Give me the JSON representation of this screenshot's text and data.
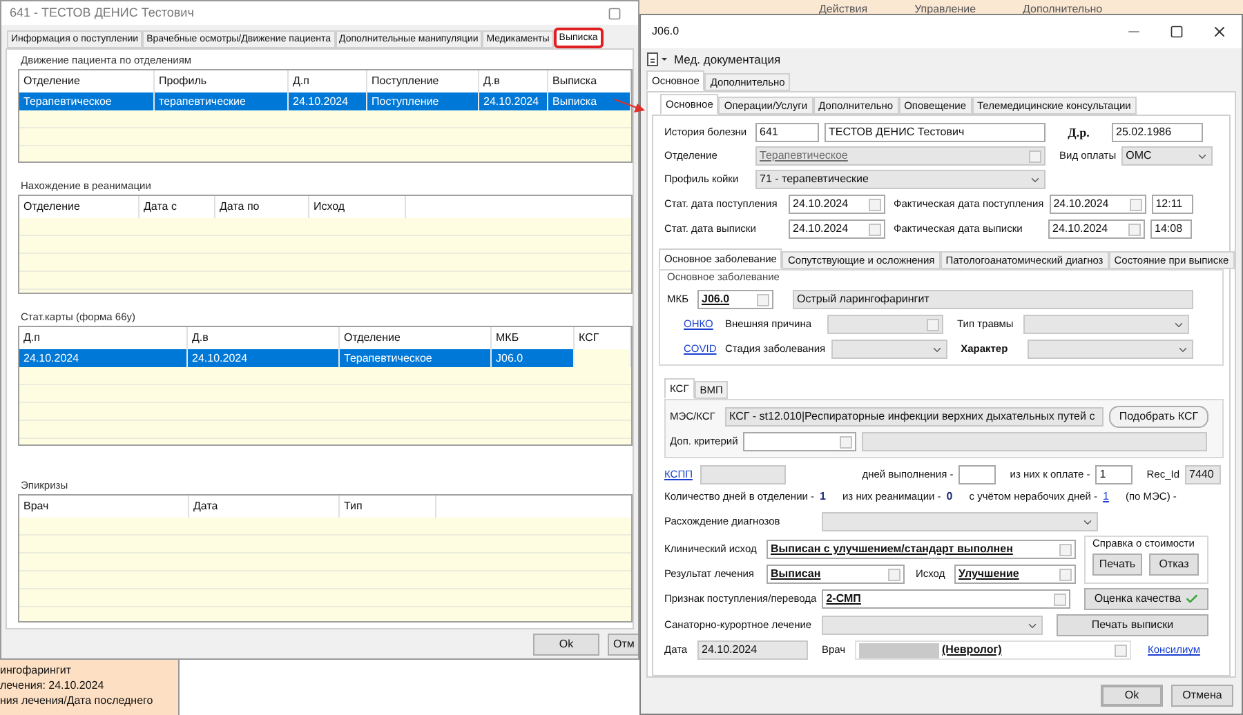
{
  "background": {
    "toolbar_labels": [
      "Действия",
      "Управление",
      "Дополнительно"
    ],
    "note_lines": [
      "ингофарингит",
      "лечения: 24.10.2024",
      "ния лечения/Дата последнего"
    ]
  },
  "left_window": {
    "title": "641 - ТЕСТОВ ДЕНИС Тестович",
    "tabs": [
      {
        "label": "Информация о поступлении",
        "selected": false,
        "highlighted": false
      },
      {
        "label": "Врачебные осмотры/Движение пациента",
        "selected": false,
        "highlighted": false
      },
      {
        "label": "Дополнительные манипуляции",
        "selected": false,
        "highlighted": false
      },
      {
        "label": "Медикаменты",
        "selected": false,
        "highlighted": false
      },
      {
        "label": "Выписка",
        "selected": true,
        "highlighted": true
      }
    ],
    "grids": [
      {
        "title": "Движение пациента по отделениям",
        "columns": [
          "Отделение",
          "Профиль",
          "Д.п",
          "Поступление",
          "Д.в",
          "Выписка"
        ],
        "rows": [
          {
            "cells": [
              "Терапевтическое",
              "терапевтические",
              "24.10.2024",
              "Поступление",
              "24.10.2024",
              "Выписка"
            ],
            "selected": true
          }
        ]
      },
      {
        "title": "Нахождение в реанимации",
        "columns": [
          "Отделение",
          "Дата с",
          "Дата по",
          "Исход"
        ]
      },
      {
        "title": "Стат.карты (форма 66у)",
        "columns": [
          "Д.п",
          "Д.в",
          "Отделение",
          "МКБ",
          "КСГ"
        ],
        "rows": [
          {
            "cells": [
              "24.10.2024",
              "24.10.2024",
              "Терапевтическое",
              "J06.0"
            ],
            "selected": true
          }
        ]
      },
      {
        "title": "Эпикризы",
        "columns": [
          "Врач",
          "Дата",
          "Тип"
        ]
      }
    ],
    "buttons": [
      "Ok",
      "Отм"
    ]
  },
  "right_window": {
    "title": "J06.0",
    "menu": "Мед. документация",
    "outer_tabs": [
      {
        "label": "Основное",
        "selected": true
      },
      {
        "label": "Дополнительно",
        "selected": false
      }
    ],
    "inner_tabs": [
      {
        "label": "Основное",
        "selected": true
      },
      {
        "label": "Операции/Услуги",
        "selected": false
      },
      {
        "label": "Дополнительно",
        "selected": false
      },
      {
        "label": "Оповещение",
        "selected": false
      },
      {
        "label": "Телемедицинские консультации",
        "selected": false
      }
    ],
    "history": {
      "label": "История болезни",
      "number": "641",
      "name": "ТЕСТОВ ДЕНИС Тестович",
      "dob_label": "Д.р.",
      "dob": "25.02.1986"
    },
    "department": {
      "label": "Отделение",
      "value": "Терапевтическое",
      "disabled": true
    },
    "payment": {
      "label": "Вид оплаты",
      "value": "ОМС"
    },
    "bed_profile": {
      "label": "Профиль койки",
      "value": "71 - терапевтические"
    },
    "dates": [
      {
        "label": "Стат. дата поступления",
        "date": "24.10.2024",
        "actual_label": "Фактическая дата поступления",
        "actual_date": "24.10.2024",
        "time": "12:11"
      },
      {
        "label": "Стат. дата выписки",
        "date": "24.10.2024",
        "actual_label": "Фактическая дата выписки",
        "actual_date": "24.10.2024",
        "time": "14:08"
      }
    ],
    "diagnosis_tabs": [
      {
        "label": "Основное заболевание",
        "selected": true
      },
      {
        "label": "Сопутствующие и осложнения",
        "selected": false
      },
      {
        "label": "Патологоанатомический диагноз",
        "selected": false
      },
      {
        "label": "Состояние при выписке",
        "selected": false
      }
    ],
    "diagnosis": {
      "group": "Основное заболевание",
      "mkb_label": "МКБ",
      "mkb": "J06.0",
      "mkb_name": "Острый ларингофарингит",
      "onko": "ОНКО",
      "external_cause": "Внешняя причина",
      "trauma_type": "Тип травмы",
      "covid": "COVID",
      "stage": "Стадия заболевания",
      "character": "Характер"
    },
    "ksg_tabs": [
      {
        "label": "КСГ",
        "selected": true
      },
      {
        "label": "ВМП",
        "selected": false
      }
    ],
    "ksg": {
      "mes_label": "МЭС/КСГ",
      "mes": "КСГ - st12.010|Респираторные инфекции верхних дыхательных путей с",
      "pick_button": "Подобрать КСГ",
      "extra_label": "Доп. критерий"
    },
    "kspp": {
      "link": "КСПП",
      "days_label": "дней выполнения -",
      "paid_label": "из них к оплате -",
      "paid": "1",
      "rec_label": "Rec_Id",
      "rec": "7440"
    },
    "counts": [
      {
        "label": "Количество дней в отделении -",
        "value": "1",
        "kind": "plain"
      },
      {
        "label": "из них реанимации -",
        "value": "0",
        "kind": "plain"
      },
      {
        "label": "с учётом нерабочих дней -",
        "value": "1",
        "kind": "link"
      }
    ],
    "mes_days_label": "(по МЭС) -",
    "discrepancy_label": "Расхождение диагнозов",
    "clinical_outcome": {
      "label": "Клинический исход",
      "value": "Выписан с улучшением/стандарт выполнен"
    },
    "result": {
      "label": "Результат лечения",
      "value": "Выписан",
      "outcome_label": "Исход",
      "outcome": "Улучшение"
    },
    "cost": {
      "group": "Справка о стоимости",
      "buttons": [
        "Печать",
        "Отказ"
      ]
    },
    "admission": {
      "label": "Признак поступления/перевода",
      "value": "2-СМП"
    },
    "quality_button": "Оценка качества",
    "sanatorium_label": "Санаторно-курортное лечение",
    "print_button": "Печать выписки",
    "date": {
      "label": "Дата",
      "value": "24.10.2024"
    },
    "doctor": {
      "label": "Врач",
      "value": "(Невролог)"
    },
    "council_link": "Консилиум",
    "buttons": [
      "Ok",
      "Отмена"
    ]
  }
}
